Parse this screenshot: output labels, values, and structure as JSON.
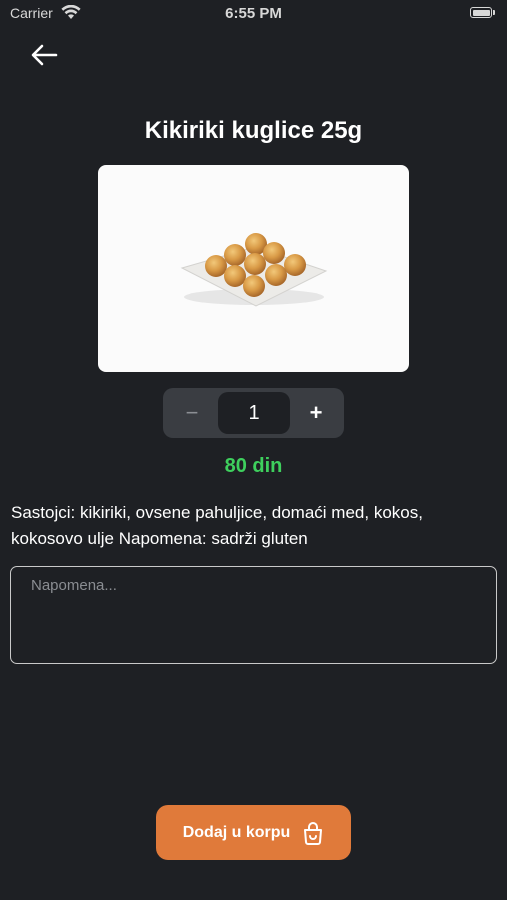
{
  "status_bar": {
    "carrier": "Carrier",
    "time": "6:55 PM"
  },
  "product": {
    "title": "Kikiriki kuglice 25g",
    "quantity": "1",
    "minus_label": "−",
    "plus_label": "+",
    "price": "80 din",
    "ingredients": "Sastojci: kikiriki, ovsene pahuljice, domaći med, kokos, kokosovo ulje Napomena: sadrži gluten"
  },
  "note": {
    "placeholder": "Napomena...",
    "value": ""
  },
  "cart_button": {
    "label": "Dodaj u korpu"
  },
  "icons": {
    "back": "arrow-left-icon",
    "cart": "shopping-bag-icon",
    "wifi": "wifi-icon",
    "battery": "battery-icon"
  },
  "colors": {
    "background": "#1e2024",
    "accent": "#e07a3a",
    "price": "#3ecf5d",
    "stepper": "#3a3d42"
  }
}
